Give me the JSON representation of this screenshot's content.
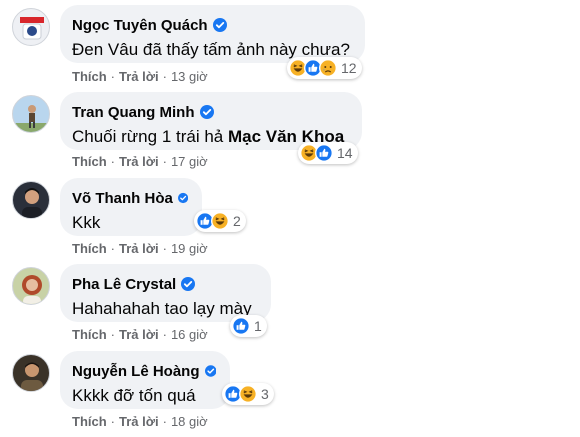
{
  "ui": {
    "verified_color": "#1877f2",
    "like_color": "#1877f2",
    "haha_color": "#f7b125"
  },
  "comments": [
    {
      "author": "Ngọc Tuyên Quách",
      "text": "Đen Vâu đã thấy tấm ảnh này chưa?",
      "mention": "",
      "like": "Thích",
      "reply": "Trả lời",
      "time": "13 giờ",
      "reactions": [
        "haha-icon",
        "like-icon",
        "sad-icon"
      ],
      "count": "12"
    },
    {
      "author": "Tran Quang Minh",
      "text": "Chuối rừng 1 trái hả ",
      "mention": "Mạc Văn Khoa",
      "like": "Thích",
      "reply": "Trả lời",
      "time": "17 giờ",
      "reactions": [
        "haha-icon",
        "like-icon"
      ],
      "count": "14"
    },
    {
      "author": "Võ Thanh Hòa",
      "text": "Kkk",
      "mention": "",
      "like": "Thích",
      "reply": "Trả lời",
      "time": "19 giờ",
      "reactions": [
        "like-icon",
        "haha-icon"
      ],
      "count": "2"
    },
    {
      "author": "Pha Lê Crystal",
      "text": "Hahahahah tao lạy mày",
      "mention": "",
      "like": "Thích",
      "reply": "Trả lời",
      "time": "16 giờ",
      "reactions": [
        "like-icon"
      ],
      "count": "1"
    },
    {
      "author": "Nguyễn Lê Hoàng",
      "text": "Kkkk đỡ tốn quá",
      "mention": "",
      "like": "Thích",
      "reply": "Trả lời",
      "time": "18 giờ",
      "reactions": [
        "like-icon",
        "haha-icon"
      ],
      "count": "3"
    }
  ]
}
